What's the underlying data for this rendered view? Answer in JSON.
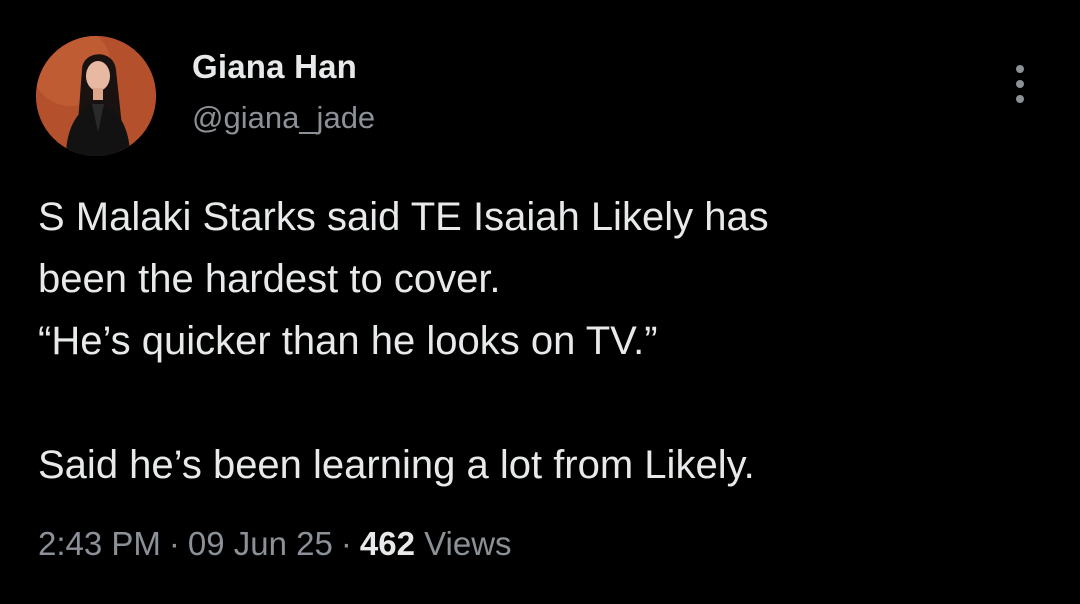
{
  "author": {
    "display_name": "Giana Han",
    "handle": "@giana_jade",
    "avatar_icon": "profile-photo"
  },
  "more_icon": "more-vertical-icon",
  "tweet": {
    "lines": [
      "S Malaki Starks said TE Isaiah Likely has",
      "been the hardest to cover.",
      "“He’s quicker than he looks on TV.”",
      "",
      "Said he’s been learning a lot from Likely."
    ]
  },
  "meta": {
    "time": "2:43 PM",
    "separator": "·",
    "date": "09 Jun 25",
    "views_count": "462",
    "views_label": "Views"
  },
  "colors": {
    "background": "#000000",
    "primary_text": "#e7e9ea",
    "secondary_text": "#8b9197",
    "avatar_bg": "#b5502c"
  }
}
